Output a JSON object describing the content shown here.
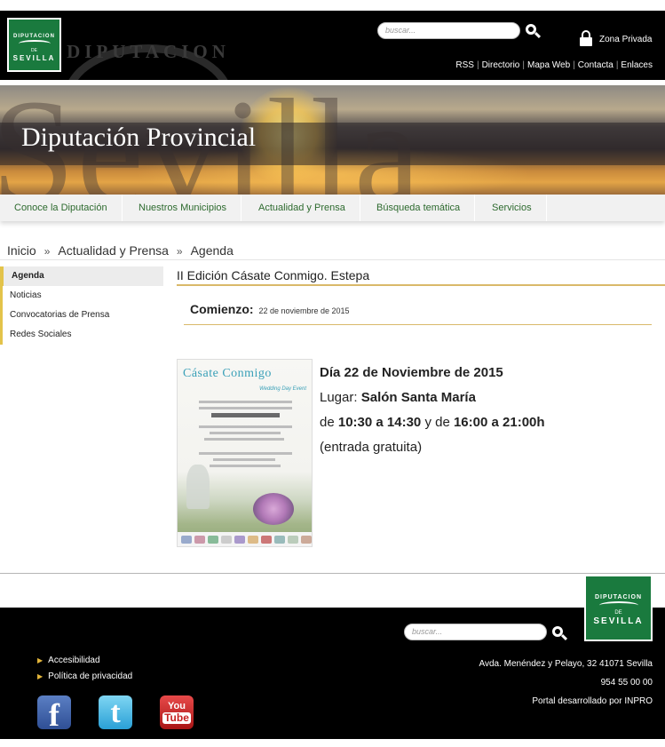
{
  "header": {
    "logo": {
      "line1": "DIPUTACION",
      "line2": "DE",
      "line3": "SEVILLA"
    },
    "wordmark": "DIPUTACION",
    "search_placeholder": "buscar...",
    "zona_privada": "Zona Privada",
    "links": [
      "RSS",
      "Directorio",
      "Mapa Web",
      "Contacta",
      "Enlaces"
    ]
  },
  "banner": {
    "title": "Diputación Provincial",
    "background_word": "Sevilla"
  },
  "nav": {
    "items": [
      "Conoce la Diputación",
      "Nuestros Municipios",
      "Actualidad y Prensa",
      "Búsqueda temática",
      "Servicios"
    ]
  },
  "breadcrumb": [
    "Inicio",
    "Actualidad y Prensa",
    "Agenda"
  ],
  "sidebar": {
    "items": [
      "Agenda",
      "Noticias",
      "Convocatorias de Prensa",
      "Redes Sociales"
    ],
    "active": "Agenda"
  },
  "event": {
    "title": "II Edición Cásate Conmigo. Estepa",
    "comienzo_label": "Comienzo:",
    "comienzo_date": "22 de noviembre de 2015",
    "poster_title": "Cásate Conmigo",
    "poster_subtitle": "Wedding Day Event",
    "date_line": "Día 22 de Noviembre de 2015",
    "place_label": "Lugar:",
    "place": "Salón Santa María",
    "time_prefix": "de",
    "time1": "10:30 a 14:30",
    "time_mid": "y de",
    "time2": "16:00 a 21:00h",
    "entry": "(entrada gratuita)"
  },
  "footer": {
    "search_placeholder": "buscar...",
    "links": [
      "Accesibilidad",
      "Política de privacidad"
    ],
    "address": "Avda. Menéndez y Pelayo, 32 41071 Sevilla",
    "phone": "954 55 00 00",
    "credit": "Portal desarrollado por INPRO",
    "social": {
      "facebook": "f",
      "twitter": "t",
      "youtube_top": "You",
      "youtube_bottom": "Tube"
    }
  },
  "colors": {
    "brand_green": "#1a7a3e",
    "nav_link": "#2d6a2e",
    "accent_gold": "#d9b96a"
  }
}
